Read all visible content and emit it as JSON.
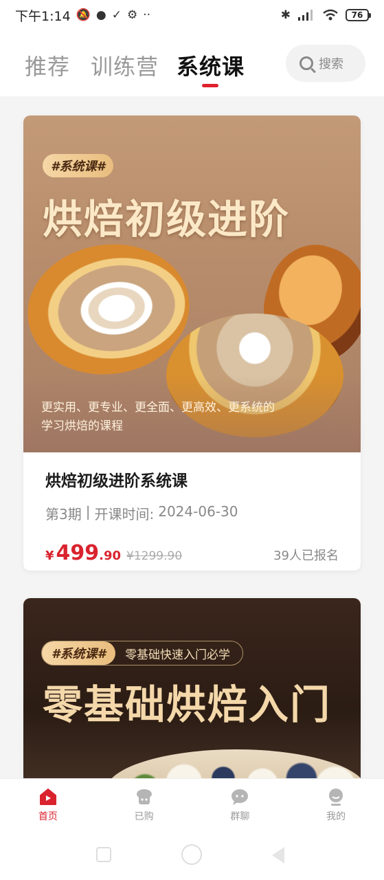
{
  "status_bar": {
    "time": "下午1:14",
    "more": "··",
    "battery": "76"
  },
  "tabs": [
    {
      "label": "推荐"
    },
    {
      "label": "训练营"
    },
    {
      "label": "系统课"
    }
  ],
  "search": {
    "label": "搜索"
  },
  "courses": [
    {
      "tag": "#系统课#",
      "banner_title": "烘焙初级进阶",
      "banner_caption_line1": "更实用、更专业、更全面、更高效、更系统的",
      "banner_caption_line2": "学习烘焙的课程",
      "title": "烘焙初级进阶系统课",
      "period": "第3期",
      "separator": "|",
      "start_label": "开课时间:",
      "start_date": "2024-06-30",
      "currency": "¥",
      "price_int": "499",
      "price_dec": ".90",
      "price_old": "¥1299.90",
      "enrolled": "39人已报名"
    },
    {
      "tag": "#系统课#",
      "tag_sub": "零基础快速入门必学",
      "banner_title": "零基础烘焙入门"
    }
  ],
  "bottom_nav": [
    {
      "label": "首页",
      "icon": "home-icon",
      "active": true
    },
    {
      "label": "已购",
      "icon": "purchased-icon",
      "active": false
    },
    {
      "label": "群聊",
      "icon": "group-chat-icon",
      "active": false
    },
    {
      "label": "我的",
      "icon": "profile-icon",
      "active": false
    }
  ],
  "colors": {
    "accent": "#d9232e",
    "tab_active": "#111111",
    "tab_inactive": "#999999"
  }
}
